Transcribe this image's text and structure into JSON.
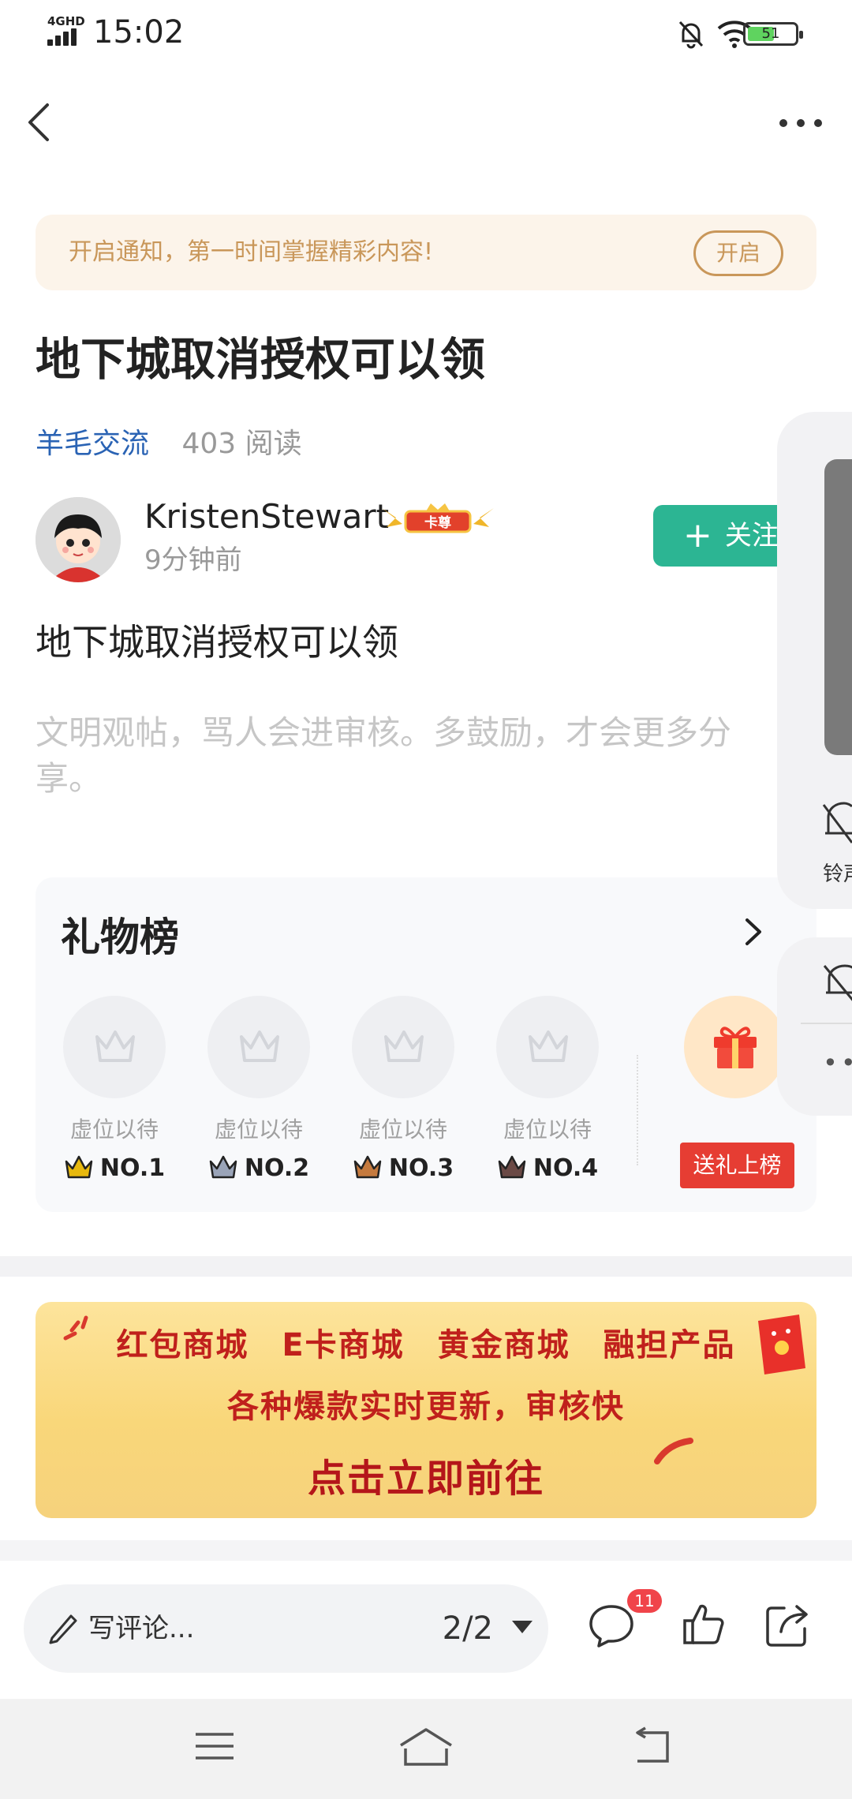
{
  "status_bar": {
    "network": "4GHD",
    "time": "15:02",
    "battery": "51",
    "icons": [
      "signal-icon",
      "mute-bell-icon",
      "wifi-icon",
      "battery-icon"
    ]
  },
  "nav": {
    "back_icon": "chevron-left-icon",
    "more_icon": "more-dots-icon"
  },
  "notice": {
    "text": "开启通知，第一时间掌握精彩内容!",
    "button": "开启"
  },
  "post": {
    "title": "地下城取消授权可以领",
    "category": "羊毛交流",
    "reads": "403 阅读",
    "author": {
      "name": "KristenStewart",
      "badge": "卡尊",
      "time": "9分钟前"
    },
    "follow_label": "关注",
    "body": "地下城取消授权可以领",
    "hint": "文明观帖，骂人会进审核。多鼓励，才会更多分享。"
  },
  "gift_board": {
    "title": "礼物榜",
    "slots": [
      {
        "label": "虚位以待",
        "rank": "NO.1",
        "crown_color": "#e8b90e"
      },
      {
        "label": "虚位以待",
        "rank": "NO.2",
        "crown_color": "#9aa4b8"
      },
      {
        "label": "虚位以待",
        "rank": "NO.3",
        "crown_color": "#c57a3e"
      },
      {
        "label": "虚位以待",
        "rank": "NO.4",
        "crown_color": "#6b4a46"
      }
    ],
    "send_button": "送礼上榜"
  },
  "ad_banner": {
    "line1": "红包商城 E卡商城 黄金商城 融担产品",
    "line2": "各种爆款实时更新，审核快",
    "line3": "点击立即前往"
  },
  "action_bar": {
    "comment_placeholder": "写评论...",
    "page_indicator": "2/2",
    "comment_count": "11"
  },
  "floating_panel": {
    "label": "铃声"
  },
  "colors": {
    "accent_green": "#2cb593",
    "link_blue": "#2a63b4",
    "notice_gold": "#c9975a",
    "gift_red": "#e63d33"
  }
}
